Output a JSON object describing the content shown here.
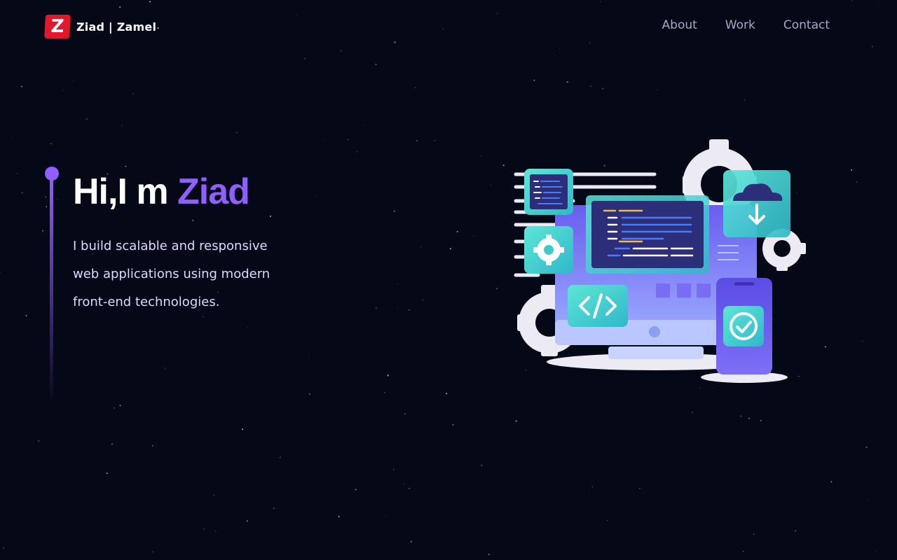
{
  "header": {
    "logo_letter": "Z",
    "brand_name": "Ziad | Zamel",
    "nav": [
      {
        "label": "About"
      },
      {
        "label": "Work"
      },
      {
        "label": "Contact"
      }
    ]
  },
  "hero": {
    "greeting": "Hi,I m ",
    "name": "Ziad",
    "subtext_lines": [
      "I build scalable and responsive",
      "web applications using modern",
      "front-end technologies."
    ]
  },
  "illustration": {
    "icons": [
      "code-window-icon",
      "gear-icon",
      "cloud-download-icon",
      "code-tag-icon",
      "check-icon",
      "monitor-icon",
      "phone-icon"
    ]
  },
  "colors": {
    "background": "#050816",
    "accent": "#915eff",
    "logo": "#e0182d",
    "nav_text": "#aaa6c3",
    "body_text": "#dfd9ff",
    "teal": "#3fd1c2"
  }
}
